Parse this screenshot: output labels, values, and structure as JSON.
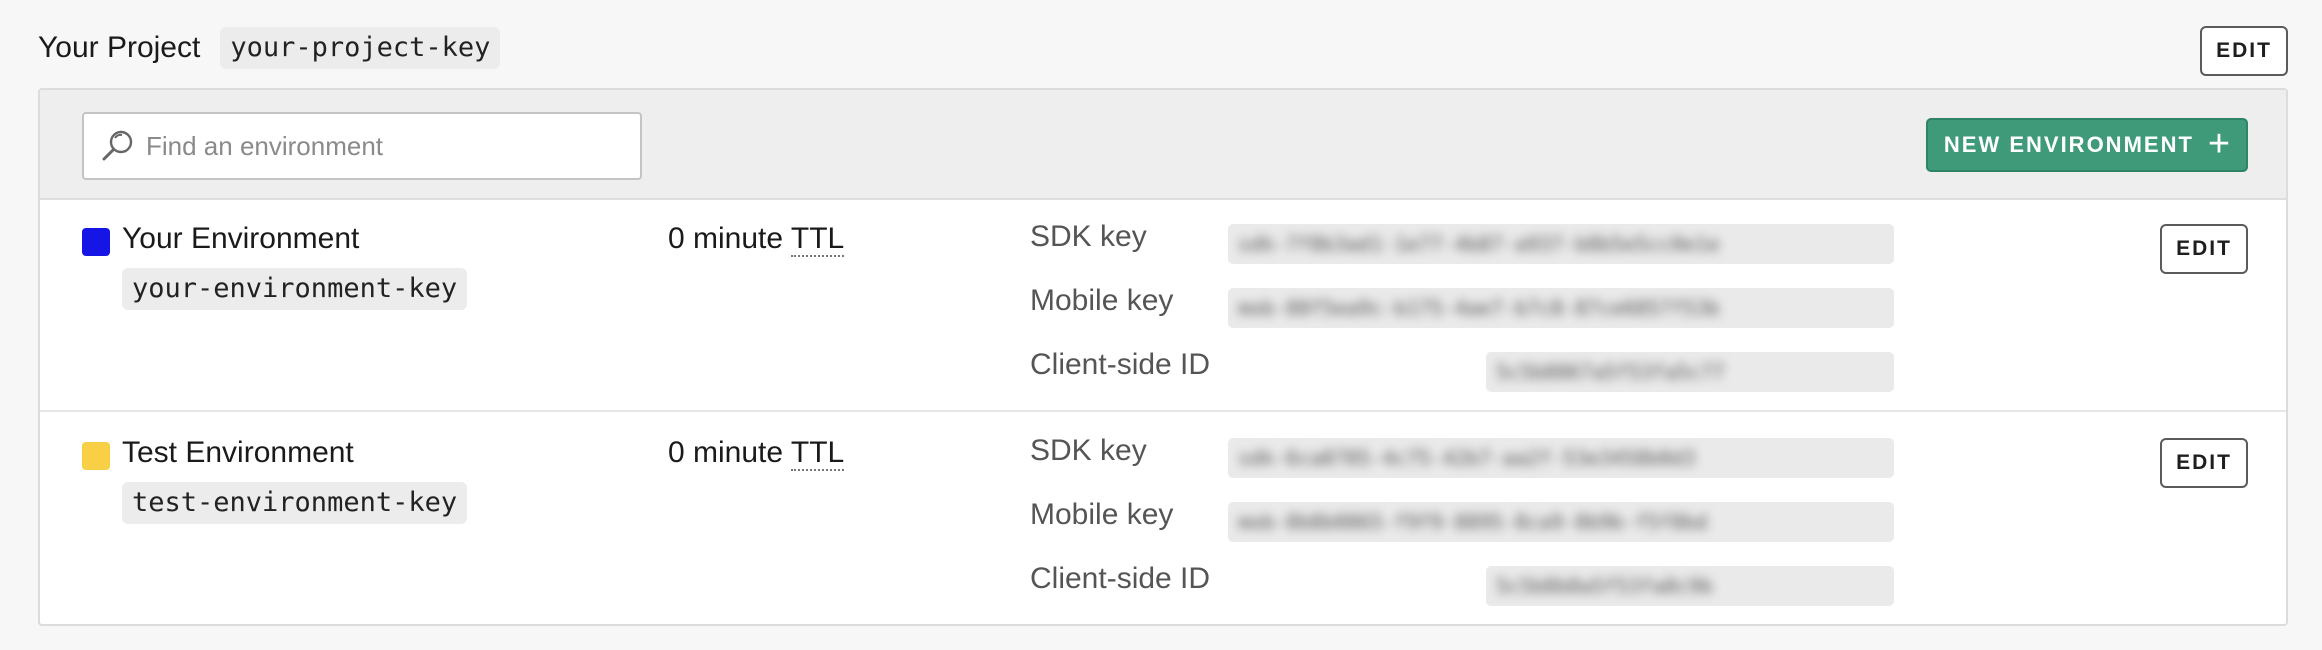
{
  "project": {
    "name": "Your Project",
    "key": "your-project-key",
    "edit_label": "EDIT"
  },
  "toolbar": {
    "search_placeholder": "Find an environment",
    "new_environment_label": "NEW ENVIRONMENT",
    "new_environment_icon": "plus-icon",
    "search_icon": "search-icon",
    "accent_color": "#3f9a7a"
  },
  "environments": [
    {
      "name": "Your Environment",
      "key": "your-environment-key",
      "color": "#1515e6",
      "ttl_value": "0 minute",
      "ttl_abbr": "TTL",
      "sdk_key_label": "SDK key",
      "sdk_key_value": "sdk-7f8b3ad1-1e77-4b87-a937-b8b5e5cc0e1e",
      "mobile_key_label": "Mobile key",
      "mobile_key_value": "mob-88f5ea9c-b175-4ae7-b7c8-87ce6857f53b",
      "client_id_label": "Client-side ID",
      "client_id_value": "5c5b8867a5f53fa5c77",
      "edit_label": "EDIT"
    },
    {
      "name": "Test Environment",
      "key": "test-environment-key",
      "color": "#f9cf45",
      "ttl_value": "0 minute",
      "ttl_abbr": "TTL",
      "sdk_key_label": "SDK key",
      "sdk_key_value": "sdk-6ca8785-4c75-42b7-aa2f-53e3458b0d3",
      "mobile_key_label": "Mobile key",
      "mobile_key_value": "mob-8b8b0865-f9f9-8895-8ca9-8b9b-f5f8bd",
      "client_id_label": "Client-side ID",
      "client_id_value": "5c5b8b8a5f53fa8c9b",
      "edit_label": "EDIT"
    }
  ]
}
